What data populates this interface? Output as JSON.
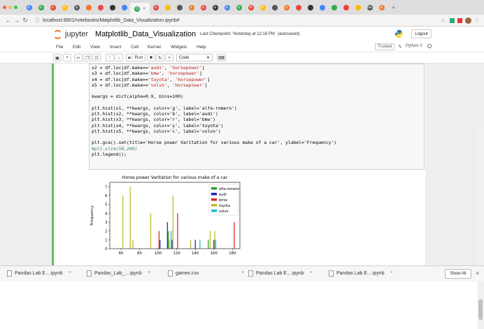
{
  "browser": {
    "tabs": [
      "G",
      "G",
      "G",
      "G",
      "G",
      "",
      "",
      "",
      "",
      "G",
      "G",
      "",
      "",
      "G",
      "G",
      "G",
      "G",
      "G",
      "W",
      "G",
      "",
      "G",
      "",
      "",
      "",
      "",
      "",
      "",
      "Ne",
      "G"
    ],
    "active_tab_close": "×",
    "new_tab": "+",
    "url": "localhost:8901/notebooks/Matplotlib_Data_Visualization.ipynb#"
  },
  "jupyter": {
    "logo_text": "jupyter",
    "notebook_name": "Matplotlib_Data_Visualization",
    "checkpoint": "Last Checkpoint: Yesterday at 12:18 PM",
    "autosave": "(autosaved)",
    "logout": "Logout",
    "menu": [
      "File",
      "Edit",
      "View",
      "Insert",
      "Cell",
      "Kernel",
      "Widgets",
      "Help"
    ],
    "trusted": "Trusted",
    "kernel": "Python 3",
    "run_label": "Run",
    "cell_type": "Code"
  },
  "code": {
    "lines": [
      [
        "x2 = df.loc[df.make==",
        "'audi'",
        ", ",
        "'horsepower'",
        "]"
      ],
      [
        "x3 = df.loc[df.make==",
        "'bmw'",
        ", ",
        "'horsepower'",
        "]"
      ],
      [
        "x4 = df.loc[df.make==",
        "'toyota'",
        ", ",
        "'horsepower'",
        "]"
      ],
      [
        "x5 = df.loc[df.make==",
        "'volvo'",
        ", ",
        "'horsepower'",
        "]"
      ]
    ],
    "kwargs": "kwargs = dict(alpha=0.9, bins=100)",
    "hist_lines": [
      "plt.hist(x1, **kwargs, color='g', label='alfa-romero')",
      "plt.hist(x2, **kwargs, color='b', label='audi')",
      "plt.hist(x3, **kwargs, color='r', label='bmw')",
      "plt.hist(x4, **kwargs, color='y', label='toyota')",
      "plt.hist(x5, **kwargs, color='c', label='volvo')"
    ],
    "set_line": "plt.gca().set(title='Horse power Varitation for various make of a car', ylabel='Frequency')",
    "comment_line": "#plt.xlim(50,200)",
    "legend_line": "plt.legend();"
  },
  "chart_data": {
    "type": "bar",
    "title": "Horse power Varitation for various make of a car",
    "ylabel": "Frequency",
    "xlabel": "",
    "xlim": [
      48,
      188
    ],
    "ylim": [
      0,
      7.5
    ],
    "xticks": [
      60,
      80,
      100,
      120,
      140,
      160,
      180
    ],
    "yticks": [
      0,
      1,
      2,
      3,
      4,
      5,
      6,
      7
    ],
    "legend_position": "top-right",
    "series": [
      {
        "name": "alfa-romero",
        "color": "#2ca02c",
        "bars": [
          [
            111,
            2
          ],
          [
            154,
            1
          ]
        ]
      },
      {
        "name": "audi",
        "color": "#2020c0",
        "bars": [
          [
            102,
            1
          ],
          [
            110,
            3
          ],
          [
            115,
            1
          ],
          [
            140,
            1
          ],
          [
            160,
            1
          ]
        ]
      },
      {
        "name": "bmw",
        "color": "#d62728",
        "bars": [
          [
            101,
            2
          ],
          [
            121,
            4
          ],
          [
            182,
            3
          ]
        ]
      },
      {
        "name": "toyota",
        "color": "#bcbd22",
        "bars": [
          [
            62,
            6
          ],
          [
            70,
            7
          ],
          [
            73,
            1
          ],
          [
            92,
            4
          ],
          [
            112,
            1
          ],
          [
            116,
            6
          ],
          [
            135,
            1
          ],
          [
            156,
            2
          ],
          [
            161,
            2
          ]
        ]
      },
      {
        "name": "volvo",
        "color": "#17becf",
        "bars": [
          [
            114,
            2
          ],
          [
            145,
            1
          ],
          [
            162,
            1
          ]
        ]
      }
    ]
  },
  "downloads": {
    "items": [
      "Pandas Lab E....ipynb",
      "Pandas_Lab_....ipynb",
      "games.csv",
      "Pandas Lab E....ipynb",
      "Pandas Lab E....ipynb"
    ],
    "show_all": "Show All",
    "close": "×"
  },
  "colors": {
    "cell_border": "#66bb6a",
    "string": "#ba2121",
    "number": "#008000",
    "comment": "#408080"
  }
}
